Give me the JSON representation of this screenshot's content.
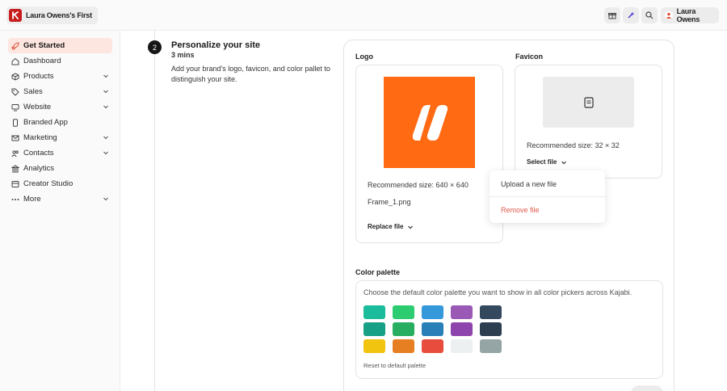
{
  "header": {
    "site_name": "Laura Owens's First",
    "user_name": "Laura Owens",
    "icons": [
      "gift-icon",
      "sparkle-icon",
      "search-icon"
    ]
  },
  "sidebar": {
    "items": [
      {
        "label": "Get Started",
        "icon": "rocket-icon",
        "active": true,
        "expandable": false
      },
      {
        "label": "Dashboard",
        "icon": "home-icon",
        "active": false,
        "expandable": false
      },
      {
        "label": "Products",
        "icon": "box-icon",
        "active": false,
        "expandable": true
      },
      {
        "label": "Sales",
        "icon": "tag-icon",
        "active": false,
        "expandable": true
      },
      {
        "label": "Website",
        "icon": "monitor-icon",
        "active": false,
        "expandable": true
      },
      {
        "label": "Branded App",
        "icon": "phone-icon",
        "active": false,
        "expandable": false
      },
      {
        "label": "Marketing",
        "icon": "mail-icon",
        "active": false,
        "expandable": true
      },
      {
        "label": "Contacts",
        "icon": "users-icon",
        "active": false,
        "expandable": true
      },
      {
        "label": "Analytics",
        "icon": "bank-icon",
        "active": false,
        "expandable": false
      },
      {
        "label": "Creator Studio",
        "icon": "film-icon",
        "active": false,
        "expandable": false
      },
      {
        "label": "More",
        "icon": "dots-icon",
        "active": false,
        "expandable": true
      }
    ]
  },
  "step": {
    "number": "2",
    "title": "Personalize your site",
    "time": "3 mins",
    "description": "Add your brand's logo, favicon, and color pallet to distinguish your site."
  },
  "logo": {
    "label": "Logo",
    "recommended": "Recommended size: 640 × 640",
    "filename": "Frame_1.png",
    "button": "Replace file"
  },
  "favicon": {
    "label": "Favicon",
    "recommended": "Recommended size: 32 × 32",
    "button": "Select file"
  },
  "dropdown": {
    "upload": "Upload a new file",
    "remove": "Remove file"
  },
  "palette": {
    "label": "Color palette",
    "description": "Choose the default color palette you want to show in all color pickers across Kajabi.",
    "reset": "Reset to default palette",
    "swatches": [
      [
        "#1abc9c",
        "#2ecc71",
        "#3498db",
        "#9b59b6",
        "#34495e"
      ],
      [
        "#16a085",
        "#27ae60",
        "#2980b9",
        "#8e44ad",
        "#2c3e50"
      ],
      [
        "#f1c40f",
        "#e67e22",
        "#e74c3c",
        "#ecf0f1",
        "#95a5a6"
      ]
    ]
  },
  "colors": {
    "accent": "#ff6a13",
    "active_nav_bg": "#fde6df",
    "danger": "#e05a4e"
  }
}
